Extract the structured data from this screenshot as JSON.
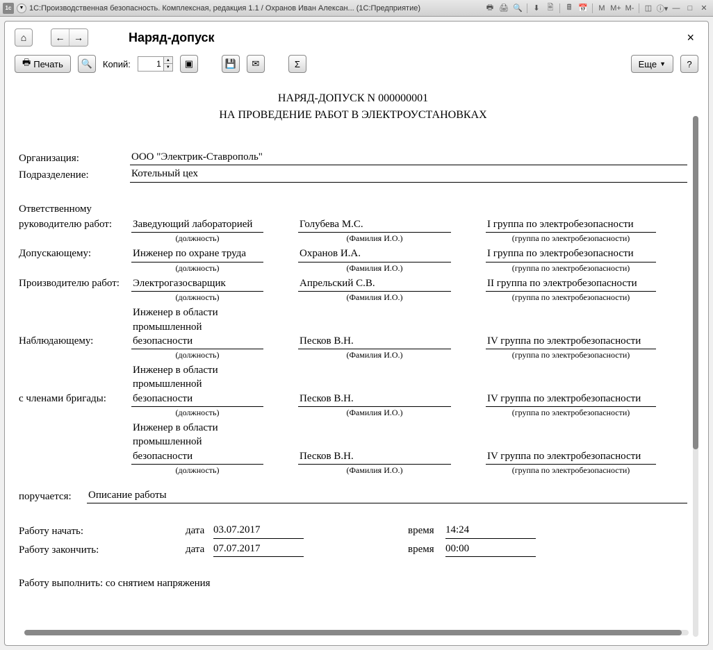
{
  "titlebar": {
    "app_title": "1С:Производственная безопасность. Комплексная, редакция 1.1 / Охранов Иван Алексан...  (1С:Предприятие)",
    "mem_m": "M",
    "mem_mplus": "M+",
    "mem_mminus": "M-"
  },
  "header": {
    "page_title": "Наряд-допуск"
  },
  "toolbar": {
    "print_label": "Печать",
    "copies_label": "Копий:",
    "copies_value": "1",
    "more_label": "Еще",
    "help_label": "?"
  },
  "doc": {
    "title": "НАРЯД-ДОПУСК N 000000001",
    "subtitle": "НА ПРОВЕДЕНИЕ РАБОТ В ЭЛЕКТРОУСТАНОВКАХ",
    "org_label": "Организация:",
    "org_value": "ООО \"Электрик-Ставрополь\"",
    "dept_label": "Подразделение:",
    "dept_value": "Котельный цех",
    "responsible_label": "Ответственному",
    "hints": {
      "position": "(должность)",
      "fio": "(Фамилия И.О.)",
      "group": "(группа по электробезопасности)"
    },
    "roles": [
      {
        "label": "руководителю работ:",
        "position": "Заведующий лабораторией",
        "fio": "Голубева М.С.",
        "group": "I группа по электробезопасности"
      },
      {
        "label": "Допускающему:",
        "position": "Инженер по охране труда",
        "fio": "Охранов И.А.",
        "group": "I группа по электробезопасности"
      },
      {
        "label": "Производителю работ:",
        "position": "Электрогазосварщик",
        "fio": "Апрельский С.В.",
        "group": "II группа по электробезопасности"
      },
      {
        "label": "Наблюдающему:",
        "position": "Инженер в области промышленной безопасности",
        "fio": "Песков В.Н.",
        "group": "IV группа по электробезопасности"
      },
      {
        "label": "с членами бригады:",
        "position": "Инженер в области промышленной безопасности",
        "fio": "Песков В.Н.",
        "group": "IV группа по электробезопасности"
      },
      {
        "label": "",
        "position": "Инженер в области промышленной безопасности",
        "fio": "Песков В.Н.",
        "group": "IV группа по электробезопасности"
      }
    ],
    "assigned_label": "поручается:",
    "assigned_value": "Описание работы",
    "start_label": "Работу начать:",
    "finish_label": "Работу закончить:",
    "date_label": "дата",
    "time_label": "время",
    "start_date": "03.07.2017",
    "start_time": "14:24",
    "finish_date": "07.07.2017",
    "finish_time": "00:00",
    "perform_label": "Работу выполнить: со снятием напряжения"
  }
}
